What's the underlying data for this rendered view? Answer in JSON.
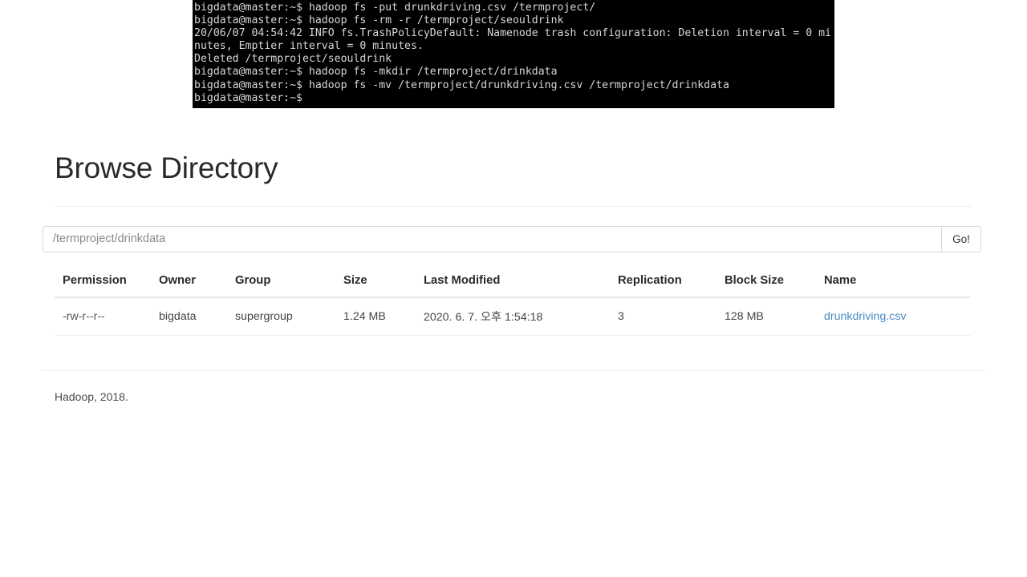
{
  "terminal": {
    "lines": [
      "bigdata@master:~$ hadoop fs -put drunkdriving.csv /termproject/",
      "bigdata@master:~$ hadoop fs -rm -r /termproject/seouldrink",
      "20/06/07 04:54:42 INFO fs.TrashPolicyDefault: Namenode trash configuration: Deletion interval = 0 mi",
      "nutes, Emptier interval = 0 minutes.",
      "Deleted /termproject/seouldrink",
      "bigdata@master:~$ hadoop fs -mkdir /termproject/drinkdata",
      "bigdata@master:~$ hadoop fs -mv /termproject/drunkdriving.csv /termproject/drinkdata",
      "bigdata@master:~$"
    ],
    "background": "#000000",
    "foreground": "#d8d8d8"
  },
  "page": {
    "title": "Browse Directory"
  },
  "path_bar": {
    "value": "/termproject/drinkdata",
    "placeholder": "/termproject/drinkdata",
    "go_label": "Go!"
  },
  "table": {
    "columns": [
      "Permission",
      "Owner",
      "Group",
      "Size",
      "Last Modified",
      "Replication",
      "Block Size",
      "Name"
    ],
    "rows": [
      {
        "permission": "-rw-r--r--",
        "owner": "bigdata",
        "group": "supergroup",
        "size": "1.24 MB",
        "last_modified": "2020. 6. 7. 오후 1:54:18",
        "replication": "3",
        "block_size": "128 MB",
        "name": "drunkdriving.csv"
      }
    ]
  },
  "footer": {
    "text": "Hadoop, 2018."
  },
  "colors": {
    "link": "#4a8bc2",
    "rule": "#eeeeee",
    "terminal_bg": "#000000"
  }
}
